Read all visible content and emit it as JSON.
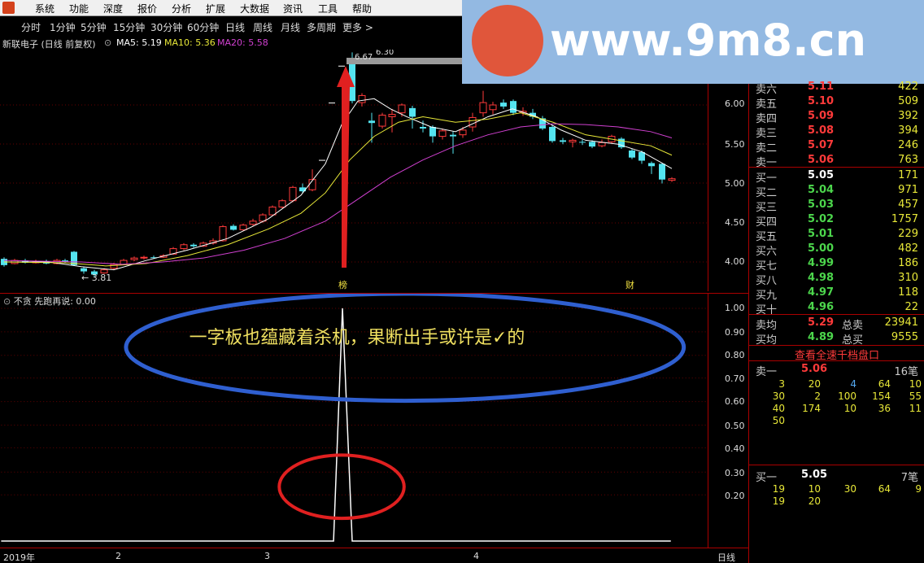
{
  "menu": {
    "items": [
      "系统",
      "功能",
      "深度",
      "报价",
      "分析",
      "扩展",
      "大数据",
      "资讯",
      "工具",
      "帮助"
    ]
  },
  "periods": {
    "items": [
      "分时",
      "1分钟",
      "5分钟",
      "15分钟",
      "30分钟",
      "60分钟",
      "日线",
      "周线",
      "月线",
      "多周期",
      "更多 >"
    ]
  },
  "stock": {
    "title": "新联电子 (日线 前复权)",
    "ma5": "MA5: 5.19",
    "ma10": "MA10: 5.36",
    "ma20": "MA20: 5.58",
    "high_label": "6.67",
    "high_label2": "6.30",
    "low_label": "3.81",
    "tag_bang": "榜",
    "tag_cai": "财"
  },
  "upper_axis": [
    "6.00",
    "5.50",
    "5.00",
    "4.50",
    "4.00"
  ],
  "indicator": {
    "title": "不贪 先跑再说: 0.00",
    "annotation": "一字板也蕴藏着杀机，果断出手或许是✓的"
  },
  "lower_axis": [
    "1.00",
    "0.90",
    "0.80",
    "0.70",
    "0.60",
    "0.50",
    "0.40",
    "0.30",
    "0.20"
  ],
  "time_axis": {
    "labels": [
      "2019年",
      "2",
      "3",
      "4"
    ],
    "period": "日线"
  },
  "watermark": {
    "text": "www.9m8.cn"
  },
  "colors": {
    "up": "#ff3a3a",
    "down": "#54e4f0",
    "ma5": "#ffffff",
    "ma10": "#e8e838",
    "ma20": "#d040d0",
    "blue_ellipse": "#2f5fd0",
    "red_ellipse": "#e02020"
  },
  "orderbook": {
    "sell": [
      {
        "label": "卖六",
        "price": "5.11",
        "vol": "422"
      },
      {
        "label": "卖五",
        "price": "5.10",
        "vol": "509"
      },
      {
        "label": "卖四",
        "price": "5.09",
        "vol": "392"
      },
      {
        "label": "卖三",
        "price": "5.08",
        "vol": "394"
      },
      {
        "label": "卖二",
        "price": "5.07",
        "vol": "246"
      },
      {
        "label": "卖一",
        "price": "5.06",
        "vol": "763"
      }
    ],
    "buy": [
      {
        "label": "买一",
        "price": "5.05",
        "vol": "171"
      },
      {
        "label": "买二",
        "price": "5.04",
        "vol": "971"
      },
      {
        "label": "买三",
        "price": "5.03",
        "vol": "457"
      },
      {
        "label": "买四",
        "price": "5.02",
        "vol": "1757"
      },
      {
        "label": "买五",
        "price": "5.01",
        "vol": "229"
      },
      {
        "label": "买六",
        "price": "5.00",
        "vol": "482"
      },
      {
        "label": "买七",
        "price": "4.99",
        "vol": "186"
      },
      {
        "label": "买八",
        "price": "4.98",
        "vol": "310"
      },
      {
        "label": "买九",
        "price": "4.97",
        "vol": "118"
      },
      {
        "label": "买十",
        "price": "4.96",
        "vol": "22"
      }
    ],
    "avg_sell_label": "卖均",
    "avg_sell_price": "5.29",
    "total_sell_label": "总卖",
    "total_sell": "23941",
    "avg_buy_label": "买均",
    "avg_buy_price": "4.89",
    "total_buy_label": "总买",
    "total_buy": "9555",
    "view_all": "查看全速千档盘口",
    "queue_sell_label": "卖一",
    "queue_sell_price": "5.06",
    "queue_sell_count": "16笔",
    "queue_sell": [
      [
        "3",
        "20",
        "4",
        "64",
        "10"
      ],
      [
        "30",
        "2",
        "100",
        "154",
        "55"
      ],
      [
        "40",
        "174",
        "10",
        "36",
        "11"
      ],
      [
        "50",
        "",
        "",
        "",
        ""
      ]
    ],
    "queue_buy_label": "买一",
    "queue_buy_price": "5.05",
    "queue_buy_count": "7笔",
    "queue_buy": [
      [
        "19",
        "10",
        "30",
        "64",
        "9"
      ],
      [
        "19",
        "20",
        "",
        "",
        ""
      ]
    ]
  }
}
